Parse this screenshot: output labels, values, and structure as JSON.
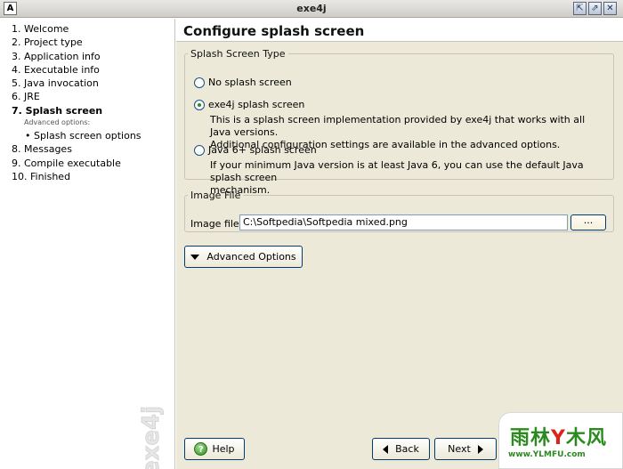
{
  "window": {
    "title": "exe4j",
    "app_icon_glyph": "A",
    "controls": [
      "⇱",
      "⇗",
      "✕"
    ]
  },
  "nav": {
    "items": [
      {
        "label": "1. Welcome"
      },
      {
        "label": "2. Project type"
      },
      {
        "label": "3. Application info"
      },
      {
        "label": "4. Executable info"
      },
      {
        "label": "5. Java invocation"
      },
      {
        "label": "6. JRE"
      },
      {
        "label": "7. Splash screen",
        "active": true
      }
    ],
    "advanced_caption": "Advanced options:",
    "advanced_item": "Splash screen options",
    "items_after": [
      {
        "label": "8. Messages"
      },
      {
        "label": "9. Compile executable"
      },
      {
        "label": "10. Finished"
      }
    ],
    "watermark": "exe4j"
  },
  "page": {
    "title": "Configure splash screen"
  },
  "splash_type": {
    "legend": "Splash Screen Type",
    "options": [
      {
        "label": "No splash screen",
        "checked": false
      },
      {
        "label": "exe4j splash screen",
        "checked": true,
        "desc_line1": "This is a splash screen implementation provided by exe4j that works with all Java versions.",
        "desc_line2": "Additional configuration settings are available in the advanced options."
      },
      {
        "label": "Java 6+ splash screen",
        "checked": false,
        "desc_line1": "If your minimum Java version is at least Java 6, you can use the default Java splash screen",
        "desc_line2": "mechanism."
      }
    ]
  },
  "image_file": {
    "legend": "Image File",
    "label": "Image file:",
    "value": "C:\\Softpedia\\Softpedia mixed.png",
    "browse_label": "..."
  },
  "buttons": {
    "advanced": "Advanced Options",
    "help": "Help",
    "help_glyph": "?",
    "back": "Back",
    "next": "Next"
  },
  "overlay_logo": {
    "line1_a": "雨林",
    "line1_b": "木风",
    "line2": "www.YLMFU.com"
  },
  "colors": {
    "panel_bg": "#ece9d8",
    "button_border": "#003c74",
    "logo_green": "#2b8a1e"
  }
}
